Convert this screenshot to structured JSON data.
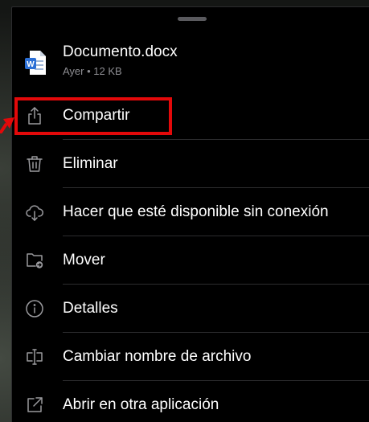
{
  "file": {
    "name": "Documento.docx",
    "meta": "Ayer • 12 KB",
    "icon": "word-document-icon",
    "icon_letter": "W"
  },
  "menu": {
    "items": [
      {
        "label": "Compartir",
        "icon": "share-icon"
      },
      {
        "label": "Eliminar",
        "icon": "trash-icon"
      },
      {
        "label": "Hacer que esté disponible sin conexión",
        "icon": "cloud-download-icon"
      },
      {
        "label": "Mover",
        "icon": "folder-move-icon"
      },
      {
        "label": "Detalles",
        "icon": "info-icon"
      },
      {
        "label": "Cambiar nombre de archivo",
        "icon": "rename-icon"
      },
      {
        "label": "Abrir en otra aplicación",
        "icon": "open-external-icon"
      }
    ]
  },
  "colors": {
    "highlight": "#e3090a",
    "sheet_background": "#000000",
    "word_blue": "#2b6fd6"
  }
}
